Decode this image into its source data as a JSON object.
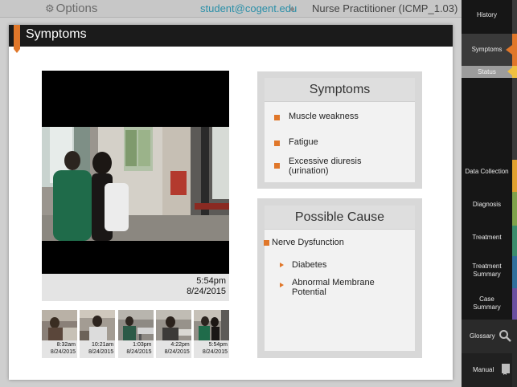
{
  "topbar": {
    "options_label": "Options",
    "email": "student@cogent.edu",
    "course": "Nurse Practitioner (ICMP_1.03)"
  },
  "panel": {
    "title": "Symptoms"
  },
  "video": {
    "time": "5:54pm",
    "date": "8/24/2015"
  },
  "thumbnails": [
    {
      "time": "8:32am",
      "date": "8/24/2015"
    },
    {
      "time": "10:21am",
      "date": "8/24/2015"
    },
    {
      "time": "1:03pm",
      "date": "8/24/2015"
    },
    {
      "time": "4:22pm",
      "date": "8/24/2015"
    },
    {
      "time": "5:54pm",
      "date": "8/24/2015"
    }
  ],
  "symptoms": {
    "heading": "Symptoms",
    "items": [
      "Muscle weakness",
      "Fatigue",
      "Excessive diuresis (urination)"
    ]
  },
  "possible_cause": {
    "heading": "Possible Cause",
    "main": "Nerve Dysfunction",
    "sub": [
      "Diabetes",
      "Abnormal Membrane Potential"
    ]
  },
  "sidebar": {
    "items": [
      {
        "label": "History"
      },
      {
        "label": "Symptoms"
      },
      {
        "label": "Status"
      },
      {
        "label": "Data Collection"
      },
      {
        "label": "Diagnosis"
      },
      {
        "label": "Treatment"
      },
      {
        "label": "Treatment Summary"
      },
      {
        "label": "Case Summary"
      },
      {
        "label": "Glossary"
      },
      {
        "label": "Manual"
      }
    ],
    "icons": {
      "options": "gear-icon",
      "glossary": "search-icon",
      "manual": "book-icon"
    }
  },
  "colors": {
    "accent": "#e0772a",
    "email": "#2a8fa8",
    "header": "#1b1b1b",
    "sidebar": "#161616"
  }
}
